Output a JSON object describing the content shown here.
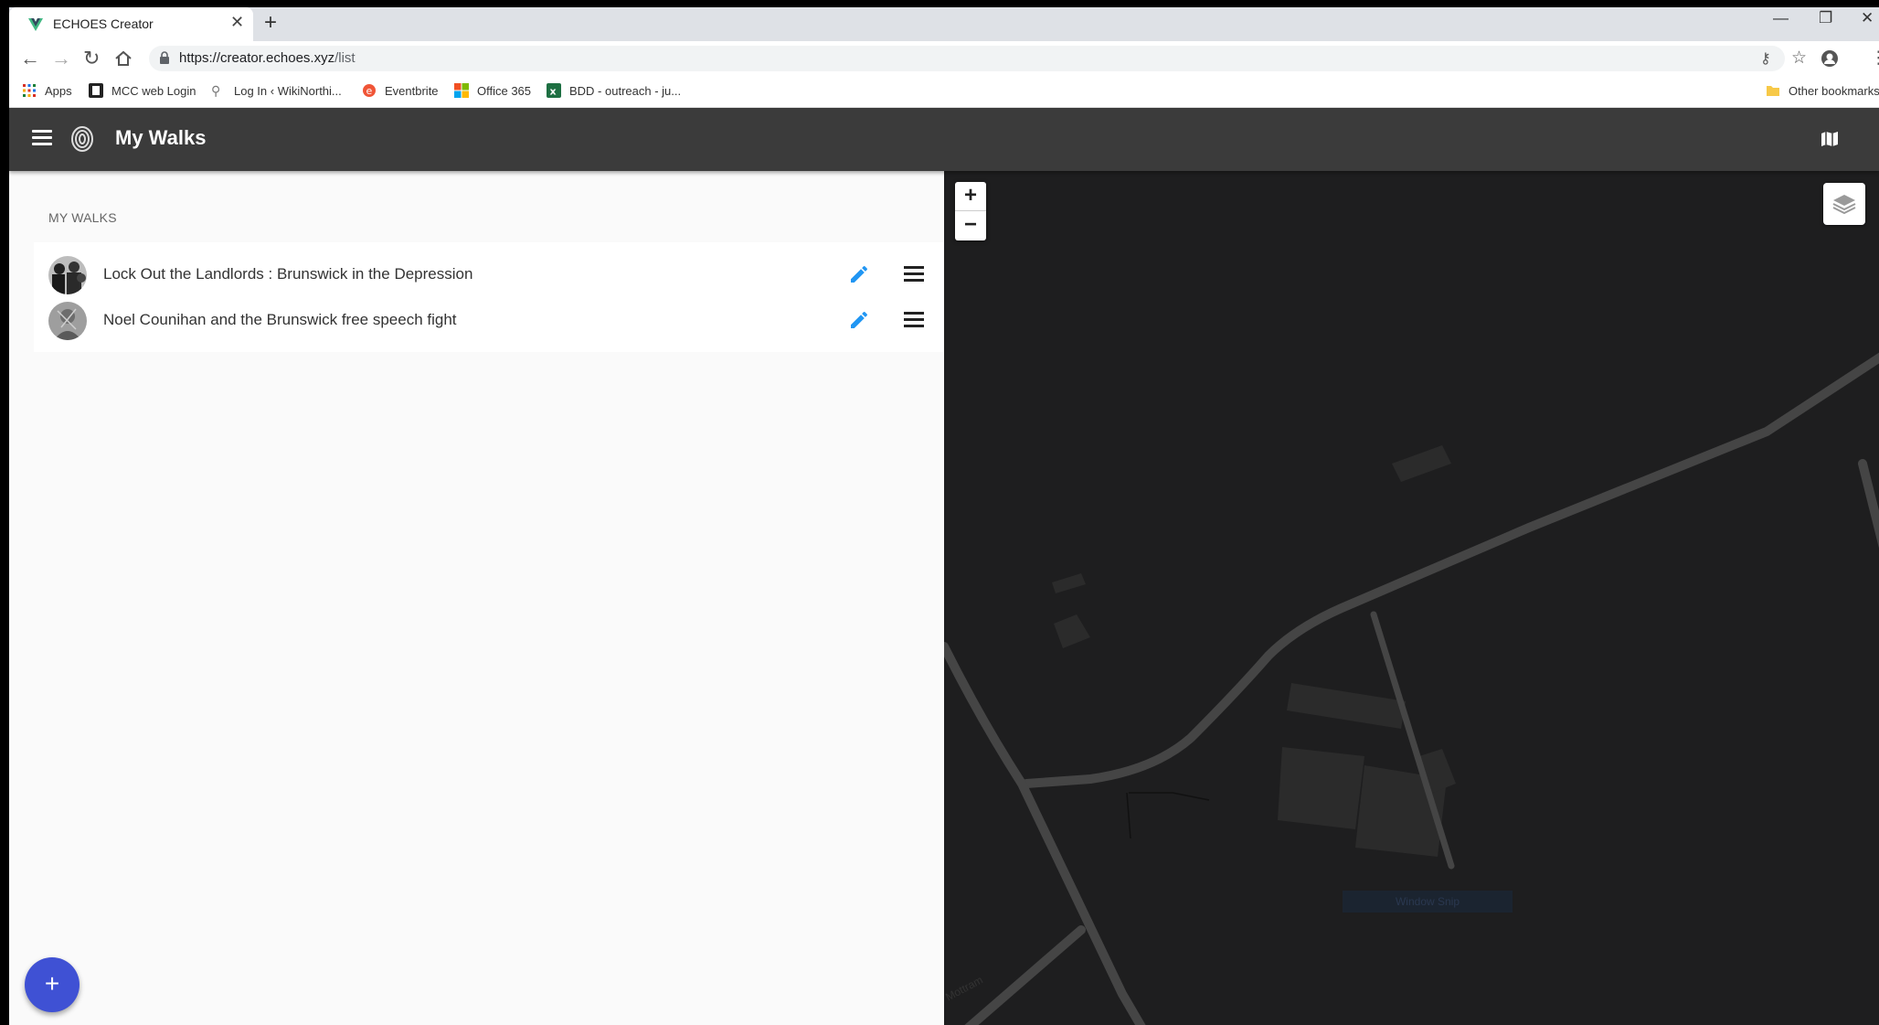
{
  "browser": {
    "tab_title": "ECHOES Creator",
    "url_host": "https://creator.echoes.xyz",
    "url_path": "/list",
    "icons": [
      "back-icon",
      "forward-icon",
      "reload-icon",
      "home-icon",
      "lock-icon",
      "key-icon",
      "star-icon",
      "profile-icon",
      "menu-dots-icon"
    ],
    "bookmarks": [
      {
        "label": "Apps",
        "icon": "apps-grid-icon"
      },
      {
        "label": "MCC web Login",
        "icon": "mcc-icon"
      },
      {
        "label": "Log In ‹ WikiNorthi...",
        "icon": "key-icon"
      },
      {
        "label": "Eventbrite",
        "icon": "eventbrite-icon"
      },
      {
        "label": "Office 365",
        "icon": "office-icon"
      },
      {
        "label": "BDD - outreach - ju...",
        "icon": "excel-icon"
      }
    ],
    "other_bookmarks": "Other bookmarks"
  },
  "app": {
    "title": "My Walks",
    "accent": "#3f51d4",
    "edit_color": "#2196f3",
    "list_header": "MY WALKS",
    "walks": [
      {
        "title": "Lock Out the Landlords : Brunswick in the Depression"
      },
      {
        "title": "Noel Counihan and the Brunswick free speech fight"
      }
    ],
    "fab_label": "+"
  },
  "map": {
    "zoom_in": "+",
    "zoom_out": "−",
    "street_label": "Mottram",
    "shop_label": "Window Snip"
  }
}
